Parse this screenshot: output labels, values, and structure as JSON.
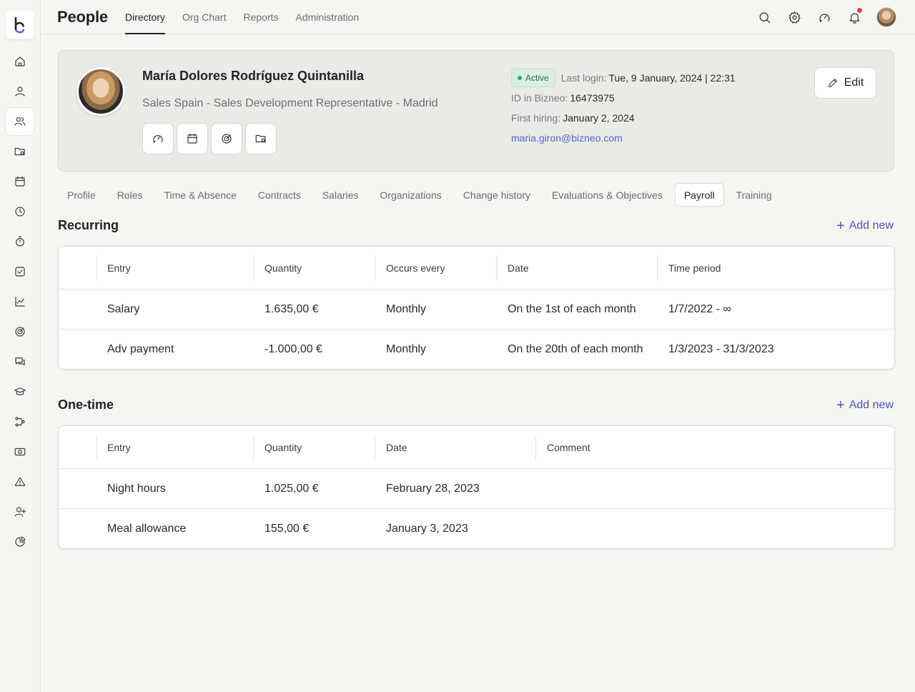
{
  "app": {
    "title": "People"
  },
  "top_nav": [
    "Directory",
    "Org Chart",
    "Reports",
    "Administration"
  ],
  "top_nav_active": "Directory",
  "sidebar": {
    "items": [
      "home-icon",
      "user-icon",
      "users-icon",
      "folder-icon",
      "calendar-icon",
      "clock-icon",
      "timer-icon",
      "check-square-icon",
      "chart-icon",
      "target-icon",
      "chat-icon",
      "graduation-cap-icon",
      "workflow-icon",
      "money-icon",
      "alert-icon",
      "user-plus-icon",
      "pie-chart-icon"
    ],
    "active": "users-icon"
  },
  "profile": {
    "name": "María Dolores Rodríguez Quintanilla",
    "role": "Sales Spain - Sales Development Representative - Madrid",
    "status": "Active",
    "last_login_label": "Last login:",
    "last_login_value": "Tue, 9 January, 2024 | 22:31",
    "id_label": "ID in Bizneo:",
    "id_value": "16473975",
    "first_hiring_label": "First hiring:",
    "first_hiring_value": "January 2, 2024",
    "email": "maria.giron@bizneo.com",
    "edit_label": "Edit"
  },
  "subtabs": [
    "Profile",
    "Roles",
    "Time & Absence",
    "Contracts",
    "Salaries",
    "Organizations",
    "Change history",
    "Evaluations & Objectives",
    "Payroll",
    "Training"
  ],
  "subtab_active": "Payroll",
  "recurring": {
    "title": "Recurring",
    "add_label": "Add new",
    "columns": [
      "Entry",
      "Quantity",
      "Occurs every",
      "Date",
      "Time period"
    ],
    "rows": [
      [
        "Salary",
        "1.635,00 €",
        "Monthly",
        "On the 1st of each month",
        "1/7/2022 - ∞"
      ],
      [
        "Adv payment",
        "-1.000,00 €",
        "Monthly",
        "On the 20th of each month",
        "1/3/2023 - 31/3/2023"
      ]
    ]
  },
  "onetime": {
    "title": "One-time",
    "add_label": "Add new",
    "columns": [
      "Entry",
      "Quantity",
      "Date",
      "Comment"
    ],
    "rows": [
      [
        "Night hours",
        "1.025,00 €",
        "February 28, 2023",
        ""
      ],
      [
        "Meal allowance",
        "155,00 €",
        "January 3, 2023",
        ""
      ]
    ]
  },
  "colors": {
    "accent": "#4a56b8",
    "status_green": "#2fae67",
    "notification": "#e0463a"
  }
}
